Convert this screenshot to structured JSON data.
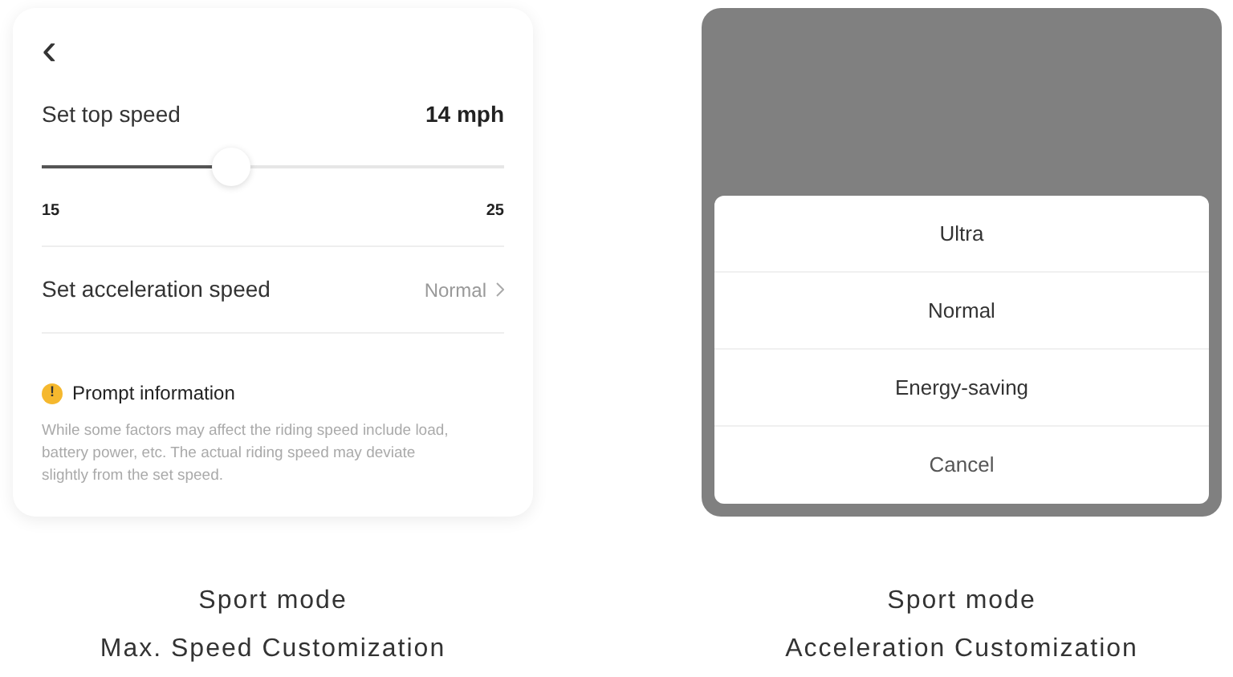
{
  "panels": [
    {
      "kind": "settings",
      "back": "‹",
      "top_speed": {
        "label": "Set top speed",
        "value": "14 mph",
        "level": 0.41,
        "min": "15",
        "max": "25"
      },
      "acceleration": {
        "label": "Set acceleration speed",
        "value": "Normal"
      },
      "prompt": {
        "icon": "!",
        "title": "Prompt information",
        "text": "While some factors may affect the riding speed include load, battery power, etc. The actual riding speed may deviate slightly from the set speed."
      },
      "caption": [
        "Sport mode",
        "Max. Speed Customization"
      ]
    },
    {
      "kind": "sheet",
      "options": [
        "Ultra",
        "Normal",
        "Energy-saving"
      ],
      "cancel": "Cancel",
      "caption": [
        "Sport mode",
        "Acceleration Customization"
      ]
    }
  ]
}
